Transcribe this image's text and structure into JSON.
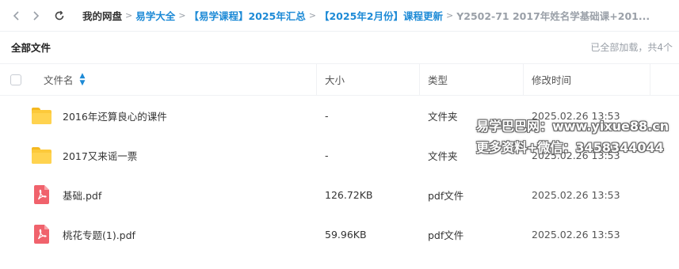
{
  "nav": {
    "back_icon": "chevron-left-icon",
    "forward_icon": "chevron-right-icon",
    "refresh_icon": "refresh-icon"
  },
  "breadcrumb": {
    "root": "我的网盘",
    "separator": ">",
    "links": [
      "易学大全",
      "【易学课程】2025年汇总",
      "【2025年2月份】课程更新"
    ],
    "current": "Y2502-71 2017年姓名学基础课+201..."
  },
  "title_bar": {
    "title": "全部文件",
    "status": "已全部加载，共4个"
  },
  "table": {
    "headers": {
      "name": "文件名",
      "size": "大小",
      "type": "类型",
      "modified": "修改时间"
    },
    "sort_icon": "sort-ascending-icon",
    "rows": [
      {
        "icon": "folder-icon",
        "name": "2016年还算良心的课件",
        "size": "-",
        "type": "文件夹",
        "modified": "2025.02.26 13:53"
      },
      {
        "icon": "folder-icon",
        "name": "2017又来谣一票",
        "size": "-",
        "type": "文件夹",
        "modified": "2025.02.26 13:53"
      },
      {
        "icon": "pdf-file-icon",
        "name": "基础.pdf",
        "size": "126.72KB",
        "type": "pdf文件",
        "modified": "2025.02.26 13:53"
      },
      {
        "icon": "pdf-file-icon",
        "name": "桃花专题(1).pdf",
        "size": "59.96KB",
        "type": "pdf文件",
        "modified": "2025.02.26 13:53"
      }
    ]
  },
  "watermark": {
    "line1": "易学巴巴网：www.yixue88.cn",
    "line2": "更多资料+微信：3458344044"
  },
  "colors": {
    "link": "#1d8ad6",
    "muted": "#9aa0a8",
    "folder": "#fcc93a",
    "pdf": "#f0626c"
  }
}
